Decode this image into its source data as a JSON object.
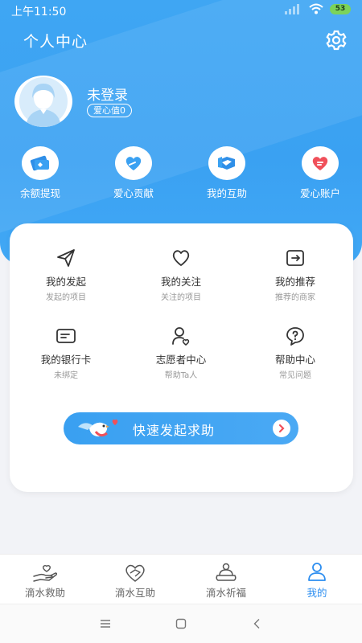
{
  "status_bar": {
    "time": "上午11:50",
    "battery": "53"
  },
  "header": {
    "title": "个人中心",
    "settings_icon": "gear-icon"
  },
  "profile": {
    "avatar_icon": "user-avatar-icon",
    "name": "未登录",
    "love_badge": "爱心值0"
  },
  "quick_actions": [
    {
      "label": "余额提现",
      "icon": "wallet-icon"
    },
    {
      "label": "爱心贡献",
      "icon": "heart-hand-icon"
    },
    {
      "label": "我的互助",
      "icon": "handshake-icon"
    },
    {
      "label": "爱心账户",
      "icon": "heart-card-icon"
    }
  ],
  "menu": [
    {
      "title": "我的发起",
      "subtitle": "发起的项目",
      "icon": "paper-plane-icon"
    },
    {
      "title": "我的关注",
      "subtitle": "关注的项目",
      "icon": "heart-outline-icon"
    },
    {
      "title": "我的推荐",
      "subtitle": "推荐的商家",
      "icon": "share-box-icon"
    },
    {
      "title": "我的银行卡",
      "subtitle": "未绑定",
      "icon": "bank-card-icon"
    },
    {
      "title": "志愿者中心",
      "subtitle": "帮助Ta人",
      "icon": "volunteer-icon"
    },
    {
      "title": "帮助中心",
      "subtitle": "常见问题",
      "icon": "question-icon"
    }
  ],
  "cta": {
    "label": "快速发起求助",
    "icon": "bird-icon",
    "arrow_icon": "chevron-right-icon"
  },
  "bottom_nav": [
    {
      "label": "滴水救助",
      "icon": "hand-heart-icon",
      "active": false
    },
    {
      "label": "滴水互助",
      "icon": "hearts-icon",
      "active": false
    },
    {
      "label": "滴水祈福",
      "icon": "blessing-icon",
      "active": false
    },
    {
      "label": "我的",
      "icon": "person-icon",
      "active": true
    }
  ],
  "colors": {
    "primary": "#3aa1f2",
    "active_tab": "#2d8ef0",
    "heart_red": "#f0505a",
    "battery_green": "#7cd35a"
  }
}
